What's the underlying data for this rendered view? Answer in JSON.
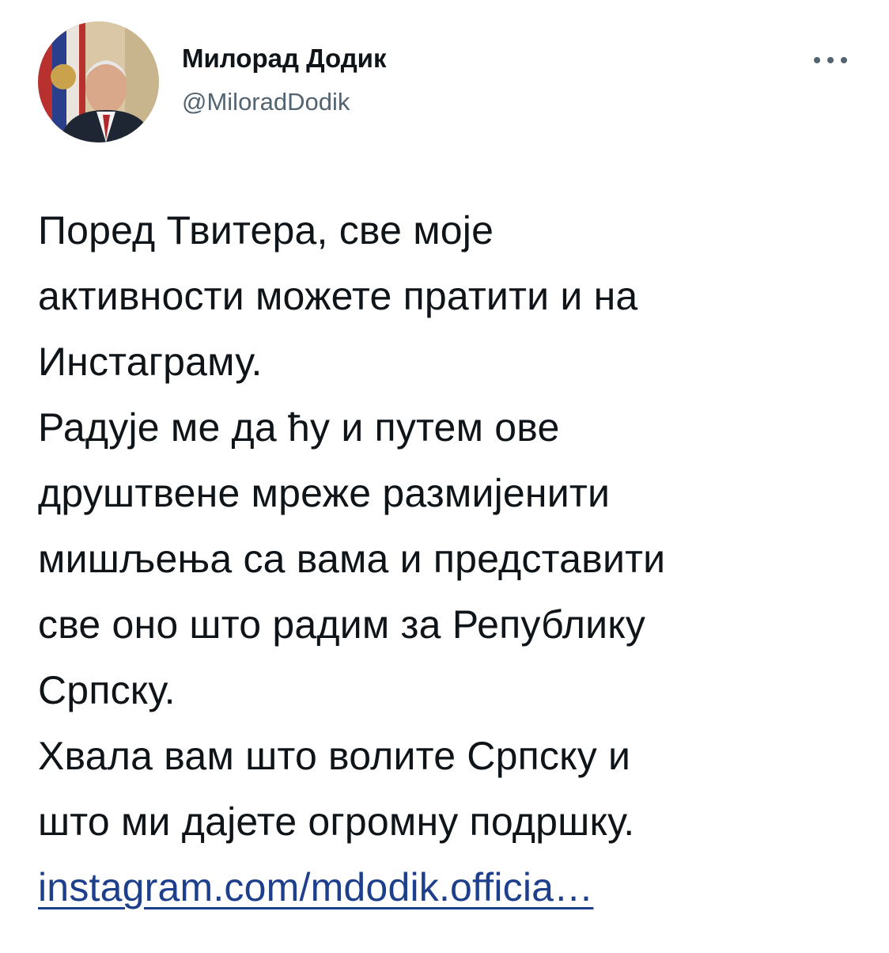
{
  "author": {
    "display_name": "Милорад Додик",
    "handle": "@MiloradDodik",
    "avatar_icon": "profile-photo"
  },
  "more_icon": "more-options-icon",
  "tweet": {
    "lines": [
      "Поред Твитера, све моје",
      "активности можете пратити и на",
      "Инстаграму.",
      "Радује ме да ћу и путем ове",
      "друштвене мреже размијенити",
      "мишљења са вама и представити",
      "све оно што радим за Републику",
      "Српску.",
      "Хвала вам што волите Српску и",
      "што ми дајете огромну подршку."
    ],
    "link_text": "instagram.com/mdodik.officia…"
  },
  "colors": {
    "text": "#0f1419",
    "secondary": "#536471",
    "link": "#1d3f8c"
  }
}
